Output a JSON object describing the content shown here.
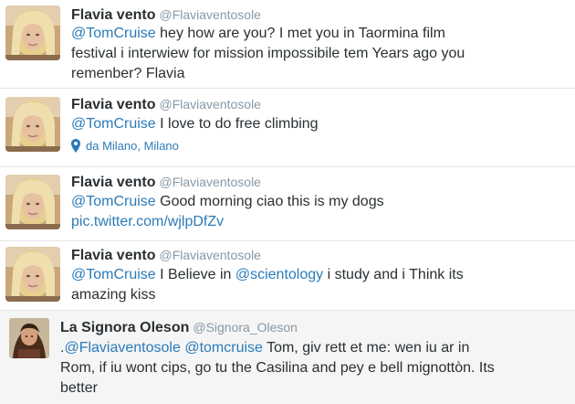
{
  "colors": {
    "link": "#2b7bb9",
    "name": "#292f33",
    "handle": "#8899a6",
    "highlight_bg": "#f5f5f5"
  },
  "tweets": [
    {
      "name": "Flavia vento",
      "handle": "@Flaviaventosole",
      "avatar_icon": "blonde-woman-avatar",
      "line1": {
        "mention": "@TomCruise",
        "text": " hey how are you? I met you in Taormina film"
      },
      "line2": "festival i interwiew for mission impossibile tem Years ago you",
      "line3": "remenber? Flavia"
    },
    {
      "name": "Flavia vento",
      "handle": "@Flaviaventosole",
      "avatar_icon": "blonde-woman-avatar",
      "line1": {
        "mention": "@TomCruise",
        "text": " I love to do free climbing"
      },
      "location": "da Milano, Milano",
      "location_icon": "location-pin-icon"
    },
    {
      "name": "Flavia vento",
      "handle": "@Flaviaventosole",
      "avatar_icon": "blonde-woman-avatar",
      "line1": {
        "mention": "@TomCruise",
        "text": " Good morning ciao this is my dogs"
      },
      "link": "pic.twitter.com/wjlpDfZv"
    },
    {
      "name": "Flavia vento",
      "handle": "@Flaviaventosole",
      "avatar_icon": "blonde-woman-avatar",
      "line1": {
        "mention": "@TomCruise",
        "text": " I Believe in ",
        "mention2": "@scientology",
        "text2": " i study and i Think its"
      },
      "line2": "amazing kiss"
    },
    {
      "name": "La Signora Oleson",
      "handle": "@Signora_Oleson",
      "avatar_icon": "woman-portrait-avatar",
      "line1": {
        "prefix": ".",
        "mention": "@Flaviaventosole",
        "space": " ",
        "mention2": "@tomcruise",
        "text": " Tom, giv rett et me: wen iu ar in"
      },
      "line2": "Rom, if iu wont cips, go tu the Casilina and pey e bell mignottòn. Its",
      "line3": "better"
    }
  ]
}
